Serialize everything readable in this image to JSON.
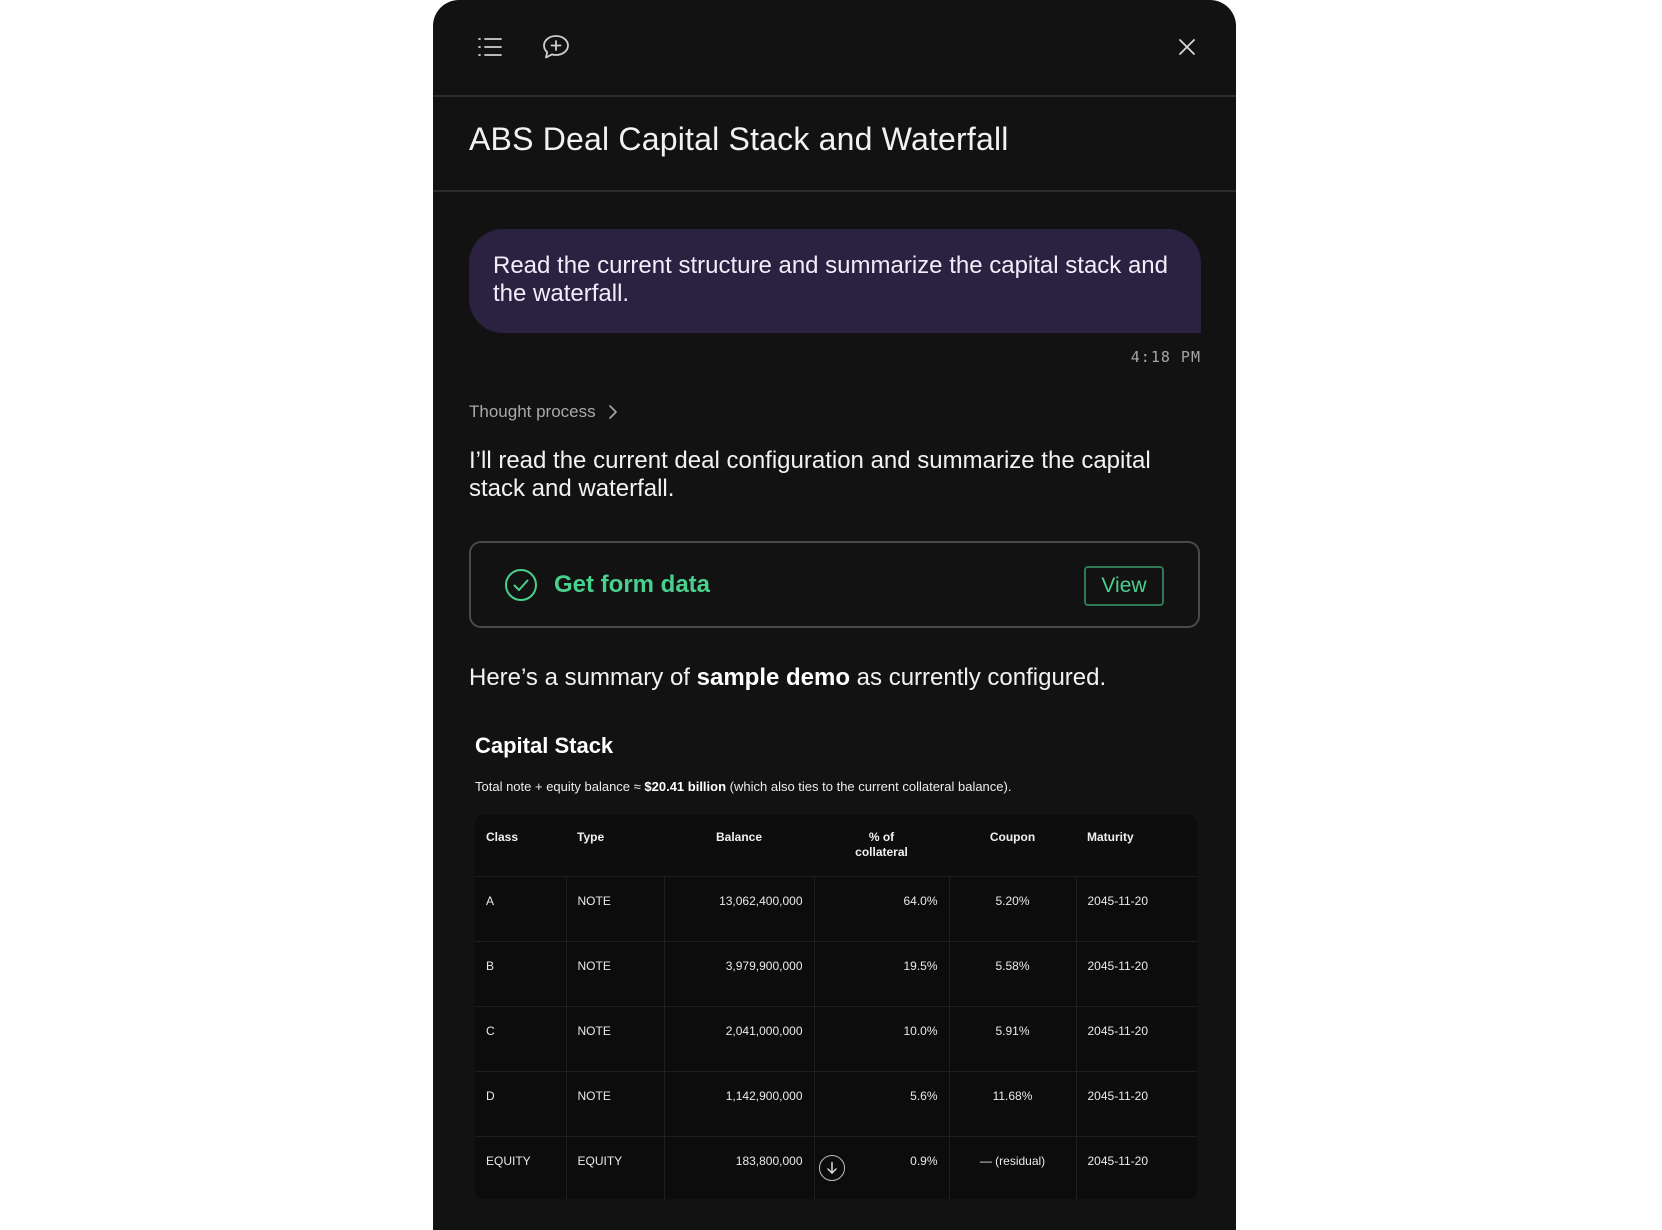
{
  "header": {
    "conversation_title": "ABS Deal Capital Stack and Waterfall",
    "icons": [
      "list-icon",
      "new-chat-icon",
      "close-icon"
    ]
  },
  "user_message": {
    "text": "Read the current structure and summarize the capital stack and the waterfall.",
    "timestamp": "4:18 PM"
  },
  "assistant": {
    "thought_label": "Thought process",
    "intro": "I’ll read the current deal configuration and summarize the capital stack and waterfall.",
    "tool_call": {
      "label": "Get form data",
      "view_label": "View"
    },
    "summary_prefix": "Here’s a summary of ",
    "summary_bold": "sample demo",
    "summary_suffix": " as currently configured.",
    "capital_stack": {
      "heading": "Capital Stack",
      "note_prefix": "Total note + equity balance ≈ ",
      "note_bold": "$20.41 billion",
      "note_suffix": " (which also ties to the current collateral balance).",
      "columns": [
        "Class",
        "Type",
        "Balance",
        "% of collateral",
        "Coupon",
        "Maturity"
      ],
      "rows": [
        [
          "A",
          "NOTE",
          "13,062,400,000",
          "64.0%",
          "5.20%",
          "2045-11-20"
        ],
        [
          "B",
          "NOTE",
          "3,979,900,000",
          "19.5%",
          "5.58%",
          "2045-11-20"
        ],
        [
          "C",
          "NOTE",
          "2,041,000,000",
          "10.0%",
          "5.91%",
          "2045-11-20"
        ],
        [
          "D",
          "NOTE",
          "1,142,900,000",
          "5.6%",
          "11.68%",
          "2045-11-20"
        ],
        [
          "EQUITY",
          "EQUITY",
          "183,800,000",
          "0.9%",
          "— (residual)",
          "2045-11-20"
        ]
      ]
    }
  },
  "colors": {
    "panel_bg": "#121212",
    "user_bubble": "#2b2140",
    "tool_accent": "#4ad08d"
  }
}
